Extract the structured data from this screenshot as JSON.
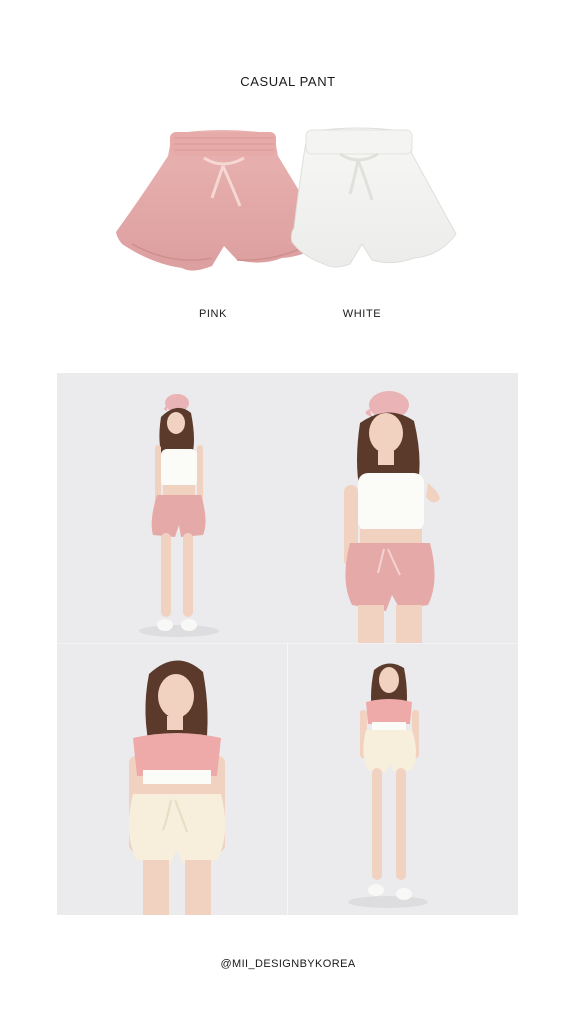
{
  "header": {
    "title": "CASUAL PANT"
  },
  "products": [
    {
      "label": "PINK",
      "color": "#e3a6a6"
    },
    {
      "label": "WHITE",
      "color": "#f3f3f1"
    }
  ],
  "footer": {
    "handle": "@MII_DESIGNBYKOREA"
  }
}
